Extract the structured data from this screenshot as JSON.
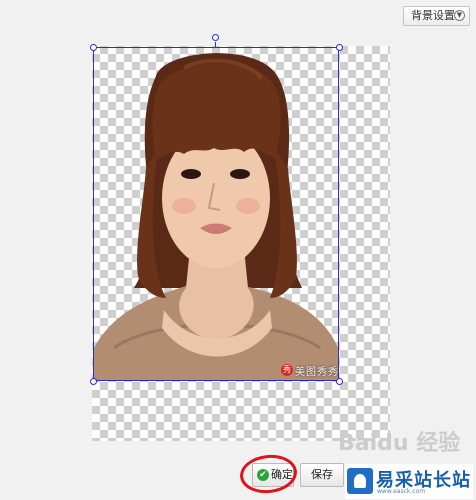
{
  "header": {
    "bg_settings_label": "背景设置"
  },
  "image": {
    "watermark_text": "美图秀秀",
    "watermark_seal": "秀"
  },
  "buttons": {
    "ok_label": "确定",
    "save_label": "保存"
  },
  "overlay": {
    "baidu_text": "Baidu 经验"
  },
  "site": {
    "name": "易采站长站",
    "url": "www.easck.com"
  },
  "colors": {
    "selection": "#2b2bd6",
    "annotation": "#e0121b",
    "ok_check": "#2aa53b"
  }
}
